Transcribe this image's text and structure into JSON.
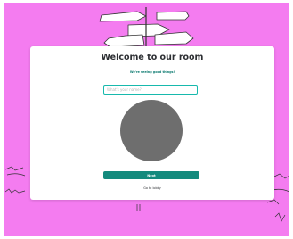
{
  "background": {
    "color": "#f47cf0"
  },
  "card": {
    "title": "Welcome to our room",
    "subtitle": "We're seeing good things!",
    "name_input": {
      "value": "",
      "placeholder": "What's your name?"
    },
    "avatar_color": "#6e6e6e",
    "next_button_label": "Next",
    "footer_link_label": "Go to lobby",
    "accent_color": "#148a7d"
  }
}
